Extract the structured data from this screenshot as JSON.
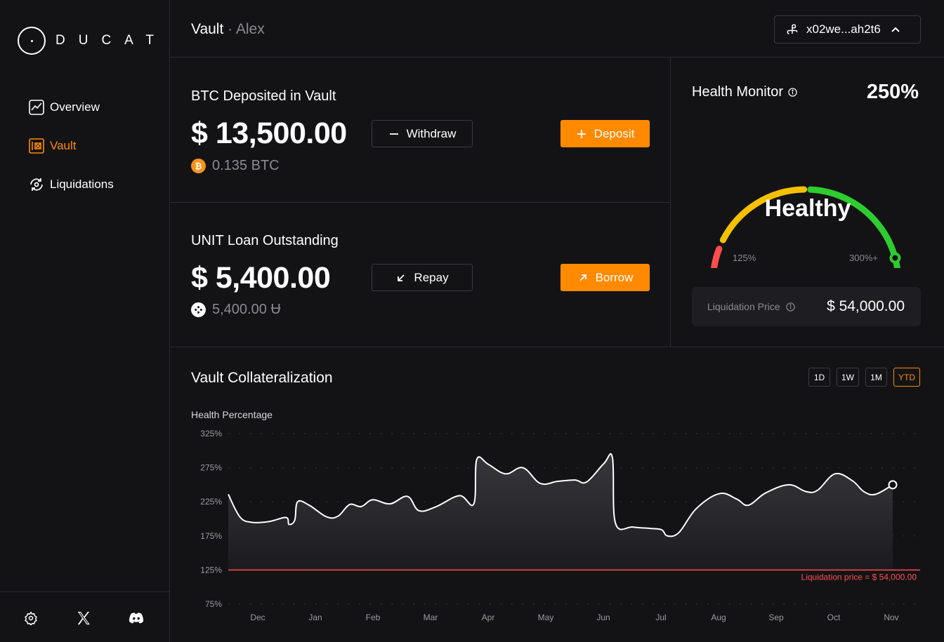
{
  "brand": {
    "name": "DUCAT"
  },
  "nav": {
    "items": [
      {
        "label": "Overview",
        "icon": "chart-line-icon",
        "active": false
      },
      {
        "label": "Vault",
        "icon": "vault-icon",
        "active": true
      },
      {
        "label": "Liquidations",
        "icon": "refresh-cycle-icon",
        "active": false
      }
    ]
  },
  "footer": {
    "icons": [
      "gear-icon",
      "x-twitter-icon",
      "discord-icon"
    ]
  },
  "header": {
    "title": "Vault",
    "separator": "·",
    "subtitle": "Alex",
    "wallet_address": "x02we...ah2t6"
  },
  "btc_card": {
    "title": "BTC Deposited in Vault",
    "amount": "$ 13,500.00",
    "sub_amount": "0.135 BTC",
    "withdraw_label": "Withdraw",
    "deposit_label": "Deposit"
  },
  "loan_card": {
    "title": "UNIT Loan Outstanding",
    "amount": "$ 5,400.00",
    "sub_amount": "5,400.00 Ʉ",
    "repay_label": "Repay",
    "borrow_label": "Borrow"
  },
  "health_monitor": {
    "title": "Health Monitor",
    "percentage": "250%",
    "status": "Healthy",
    "gauge_min": "125%",
    "gauge_max": "300%+",
    "gauge_value_fraction": 0.85,
    "liquidation_price_label": "Liquidation Price",
    "liquidation_price_value": "$ 54,000.00"
  },
  "colors": {
    "accent": "#ff8a00",
    "danger": "#ff4d4d",
    "warning": "#f5c000",
    "success": "#2ecc2e"
  },
  "chart": {
    "title": "Vault Collateralization",
    "ranges": [
      {
        "label": "1D",
        "active": false
      },
      {
        "label": "1W",
        "active": false
      },
      {
        "label": "1M",
        "active": false
      },
      {
        "label": "YTD",
        "active": true
      }
    ]
  },
  "chart_data": {
    "type": "area",
    "title": "",
    "ylabel": "Health Percentage",
    "xlabel": "",
    "ylim": [
      75,
      325
    ],
    "y_ticks": [
      "325%",
      "275%",
      "225%",
      "175%",
      "125%",
      "75%"
    ],
    "y_tick_values": [
      325,
      275,
      225,
      175,
      125,
      75
    ],
    "x_tick_labels": [
      "Dec",
      "Jan",
      "Feb",
      "Mar",
      "Apr",
      "May",
      "Jun",
      "Jul",
      "Aug",
      "Sep",
      "Oct",
      "Nov"
    ],
    "x_range": [
      -0.5,
      11.05
    ],
    "points": [
      [
        -0.5,
        236
      ],
      [
        -0.3,
        203
      ],
      [
        -0.1,
        195
      ],
      [
        0.2,
        196
      ],
      [
        0.5,
        202
      ],
      [
        0.55,
        192
      ],
      [
        0.65,
        198
      ],
      [
        0.7,
        225
      ],
      [
        0.9,
        220
      ],
      [
        1.2,
        203
      ],
      [
        1.4,
        204
      ],
      [
        1.6,
        221
      ],
      [
        1.8,
        218
      ],
      [
        2.0,
        228
      ],
      [
        2.3,
        222
      ],
      [
        2.6,
        233
      ],
      [
        2.8,
        212
      ],
      [
        3.1,
        218
      ],
      [
        3.5,
        234
      ],
      [
        3.75,
        222
      ],
      [
        3.8,
        287
      ],
      [
        4.0,
        280
      ],
      [
        4.3,
        266
      ],
      [
        4.6,
        275
      ],
      [
        4.9,
        252
      ],
      [
        5.2,
        255
      ],
      [
        5.5,
        257
      ],
      [
        5.7,
        254
      ],
      [
        6.0,
        281
      ],
      [
        6.15,
        289
      ],
      [
        6.2,
        194
      ],
      [
        6.5,
        188
      ],
      [
        6.8,
        186
      ],
      [
        7.0,
        184
      ],
      [
        7.1,
        175
      ],
      [
        7.3,
        180
      ],
      [
        7.6,
        215
      ],
      [
        8.0,
        237
      ],
      [
        8.3,
        229
      ],
      [
        8.5,
        220
      ],
      [
        8.8,
        238
      ],
      [
        9.2,
        250
      ],
      [
        9.5,
        240
      ],
      [
        9.7,
        242
      ],
      [
        10.0,
        266
      ],
      [
        10.3,
        256
      ],
      [
        10.5,
        240
      ],
      [
        10.7,
        236
      ],
      [
        11.0,
        250
      ]
    ],
    "threshold": {
      "value": 125,
      "label": "Liquidation price = $ 54,000.00"
    },
    "grid": true,
    "legend": "none"
  }
}
